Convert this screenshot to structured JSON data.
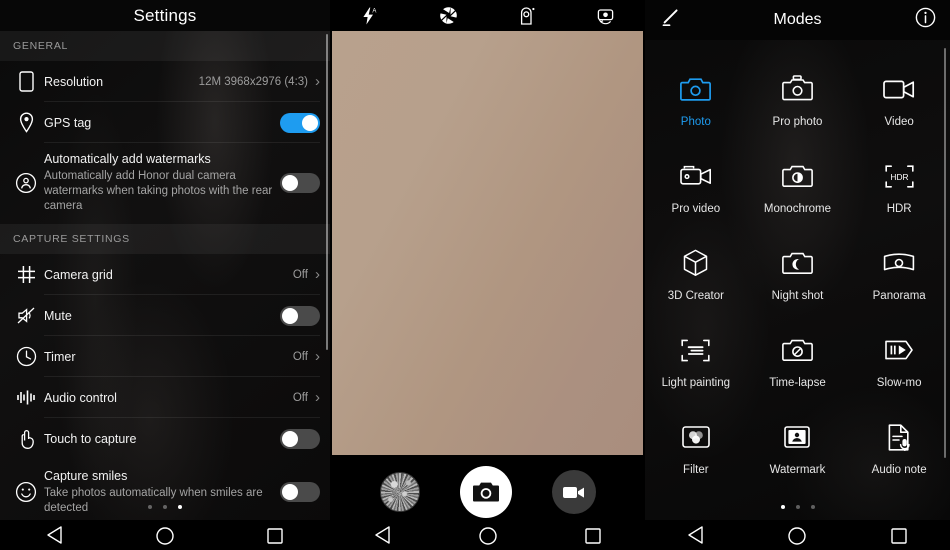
{
  "settings": {
    "title": "Settings",
    "sections": [
      {
        "header": "GENERAL",
        "rows": [
          {
            "icon": "resolution-icon",
            "label": "Resolution",
            "value": "12M 3968x2976 (4:3)",
            "control": "chevron"
          },
          {
            "icon": "gps-pin-icon",
            "label": "GPS tag",
            "control": "toggle",
            "toggle_on": true
          },
          {
            "icon": "watermark-person-icon",
            "label": "Automatically add watermarks",
            "sublabel": "Automatically add Honor dual camera watermarks when taking photos with the rear camera",
            "control": "toggle",
            "toggle_on": false
          }
        ]
      },
      {
        "header": "CAPTURE SETTINGS",
        "rows": [
          {
            "icon": "grid-icon",
            "label": "Camera grid",
            "value": "Off",
            "control": "chevron"
          },
          {
            "icon": "mute-icon",
            "label": "Mute",
            "control": "toggle",
            "toggle_on": false
          },
          {
            "icon": "timer-clock-icon",
            "label": "Timer",
            "value": "Off",
            "control": "chevron"
          },
          {
            "icon": "audio-control-icon",
            "label": "Audio control",
            "value": "Off",
            "control": "chevron"
          },
          {
            "icon": "touch-capture-icon",
            "label": "Touch to capture",
            "control": "toggle",
            "toggle_on": false
          },
          {
            "icon": "smile-icon",
            "label": "Capture smiles",
            "sublabel": "Take photos automatically when smiles are detected",
            "control": "toggle",
            "toggle_on": false
          }
        ]
      }
    ],
    "page_dots": {
      "count": 3,
      "active_index": 2
    }
  },
  "camera": {
    "topbar_icons": [
      {
        "name": "flash-auto-icon"
      },
      {
        "name": "aperture-icon"
      },
      {
        "name": "moving-picture-icon"
      },
      {
        "name": "switch-camera-icon"
      }
    ],
    "controls": {
      "gallery_thumbnail": "gallery-thumbnail",
      "shutter": "shutter-button",
      "video": "video-record-button"
    },
    "page_dots": {
      "count": 3,
      "active_index": 1
    }
  },
  "modes": {
    "title": "Modes",
    "edit_icon": "edit-pencil-icon",
    "info_icon": "info-icon",
    "accent_color": "#1e9cf0",
    "items": [
      {
        "label": "Photo",
        "icon": "photo-camera-icon",
        "active": true
      },
      {
        "label": "Pro photo",
        "icon": "pro-photo-icon",
        "active": false
      },
      {
        "label": "Video",
        "icon": "video-camera-icon",
        "active": false
      },
      {
        "label": "Pro video",
        "icon": "pro-video-icon",
        "active": false
      },
      {
        "label": "Monochrome",
        "icon": "monochrome-icon",
        "active": false
      },
      {
        "label": "HDR",
        "icon": "hdr-icon",
        "active": false
      },
      {
        "label": "3D Creator",
        "icon": "cube-3d-icon",
        "active": false
      },
      {
        "label": "Night shot",
        "icon": "night-shot-icon",
        "active": false
      },
      {
        "label": "Panorama",
        "icon": "panorama-icon",
        "active": false
      },
      {
        "label": "Light painting",
        "icon": "light-painting-icon",
        "active": false
      },
      {
        "label": "Time-lapse",
        "icon": "time-lapse-icon",
        "active": false
      },
      {
        "label": "Slow-mo",
        "icon": "slow-mo-icon",
        "active": false
      },
      {
        "label": "Filter",
        "icon": "filter-icon",
        "active": false
      },
      {
        "label": "Watermark",
        "icon": "watermark-stamp-icon",
        "active": false
      },
      {
        "label": "Audio note",
        "icon": "audio-note-icon",
        "active": false
      }
    ],
    "page_dots": {
      "count": 3,
      "active_index": 0
    }
  },
  "navbar": {
    "back": "back-triangle-icon",
    "home": "home-circle-icon",
    "recents": "recents-square-icon"
  }
}
